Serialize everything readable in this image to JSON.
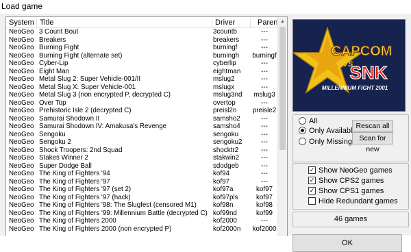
{
  "window": {
    "title": "Load game"
  },
  "list": {
    "columns": [
      "System",
      "Title",
      "Driver",
      "Parent"
    ],
    "rows": [
      [
        "NeoGeo",
        "3 Count Bout",
        "3countb",
        "---"
      ],
      [
        "NeoGeo",
        "Breakers",
        "breakers",
        "---"
      ],
      [
        "NeoGeo",
        "Burning Fight",
        "burningf",
        "---"
      ],
      [
        "NeoGeo",
        "Burning Fight (alternate set)",
        "burningh",
        "burningf"
      ],
      [
        "NeoGeo",
        "Cyber-Lip",
        "cyberlip",
        "---"
      ],
      [
        "NeoGeo",
        "Eight Man",
        "eightman",
        "---"
      ],
      [
        "NeoGeo",
        "Metal Slug 2: Super Vehicle-001/II",
        "mslug2",
        "---"
      ],
      [
        "NeoGeo",
        "Metal Slug X: Super Vehicle-001",
        "mslugx",
        "---"
      ],
      [
        "NeoGeo",
        "Metal Slug 3 (non encrypted P, decrypted C)",
        "mslug3nd",
        "mslug3"
      ],
      [
        "NeoGeo",
        "Over Top",
        "overtop",
        "---"
      ],
      [
        "NeoGeo",
        "Prehistoric Isle 2 (decrypted C)",
        "preisl2n",
        "preisle2"
      ],
      [
        "NeoGeo",
        "Samurai Shodown II",
        "samsho2",
        "---"
      ],
      [
        "NeoGeo",
        "Samurai Shodown IV: Amakusa's Revenge",
        "samsho4",
        "---"
      ],
      [
        "NeoGeo",
        "Sengoku",
        "sengoku",
        "---"
      ],
      [
        "NeoGeo",
        "Sengoku 2",
        "sengoku2",
        "---"
      ],
      [
        "NeoGeo",
        "Shock Troopers: 2nd Squad",
        "shocktr2",
        "---"
      ],
      [
        "NeoGeo",
        "Stakes Winner 2",
        "stakwin2",
        "---"
      ],
      [
        "NeoGeo",
        "Super Dodge Ball",
        "sdodgeb",
        "---"
      ],
      [
        "NeoGeo",
        "The King of Fighters '94",
        "kof94",
        "---"
      ],
      [
        "NeoGeo",
        "The King of Fighters '97",
        "kof97",
        "---"
      ],
      [
        "NeoGeo",
        "The King of Fighters '97 (set 2)",
        "kof97a",
        "kof97"
      ],
      [
        "NeoGeo",
        "The King of Fighters '97 (hack)",
        "kof97pls",
        "kof97"
      ],
      [
        "NeoGeo",
        "The King of Fighters '98: The Slugfest (censored M1)",
        "kof98n",
        "kof98"
      ],
      [
        "NeoGeo",
        "The King of Fighters '99: Millennium Battle (decrypted C)",
        "kof99nd",
        "kof99"
      ],
      [
        "NeoGeo",
        "The King of Fighters 2000",
        "kof2000",
        "---"
      ],
      [
        "NeoGeo",
        "The King of Fighters 2000 (non encrypted P)",
        "kof2000n",
        "kof2000"
      ]
    ]
  },
  "preview": {
    "logo_top": "CAPCOM",
    "logo_vs": "VS",
    "logo_bottom": "SNK",
    "subtitle": "MILLENNIUM FIGHT 2001",
    "colors": {
      "bg": "#1a2a55",
      "star": "#f2c21a",
      "snk": "#e8201c",
      "capcom": "#f5d23a"
    }
  },
  "filter": {
    "options": [
      "All",
      "Only Available",
      "Only Missing"
    ],
    "selected": "Only Available",
    "rescan_label": "Rescan all",
    "scan_new_label": "Scan for new"
  },
  "show": {
    "items": [
      {
        "label": "Show NeoGeo games",
        "checked": true
      },
      {
        "label": "Show CPS2 games",
        "checked": true
      },
      {
        "label": "Show CPS1 games",
        "checked": true
      },
      {
        "label": "Hide Redundant games",
        "checked": false
      }
    ]
  },
  "status": {
    "count_text": "46 games"
  },
  "ok_label": "OK"
}
